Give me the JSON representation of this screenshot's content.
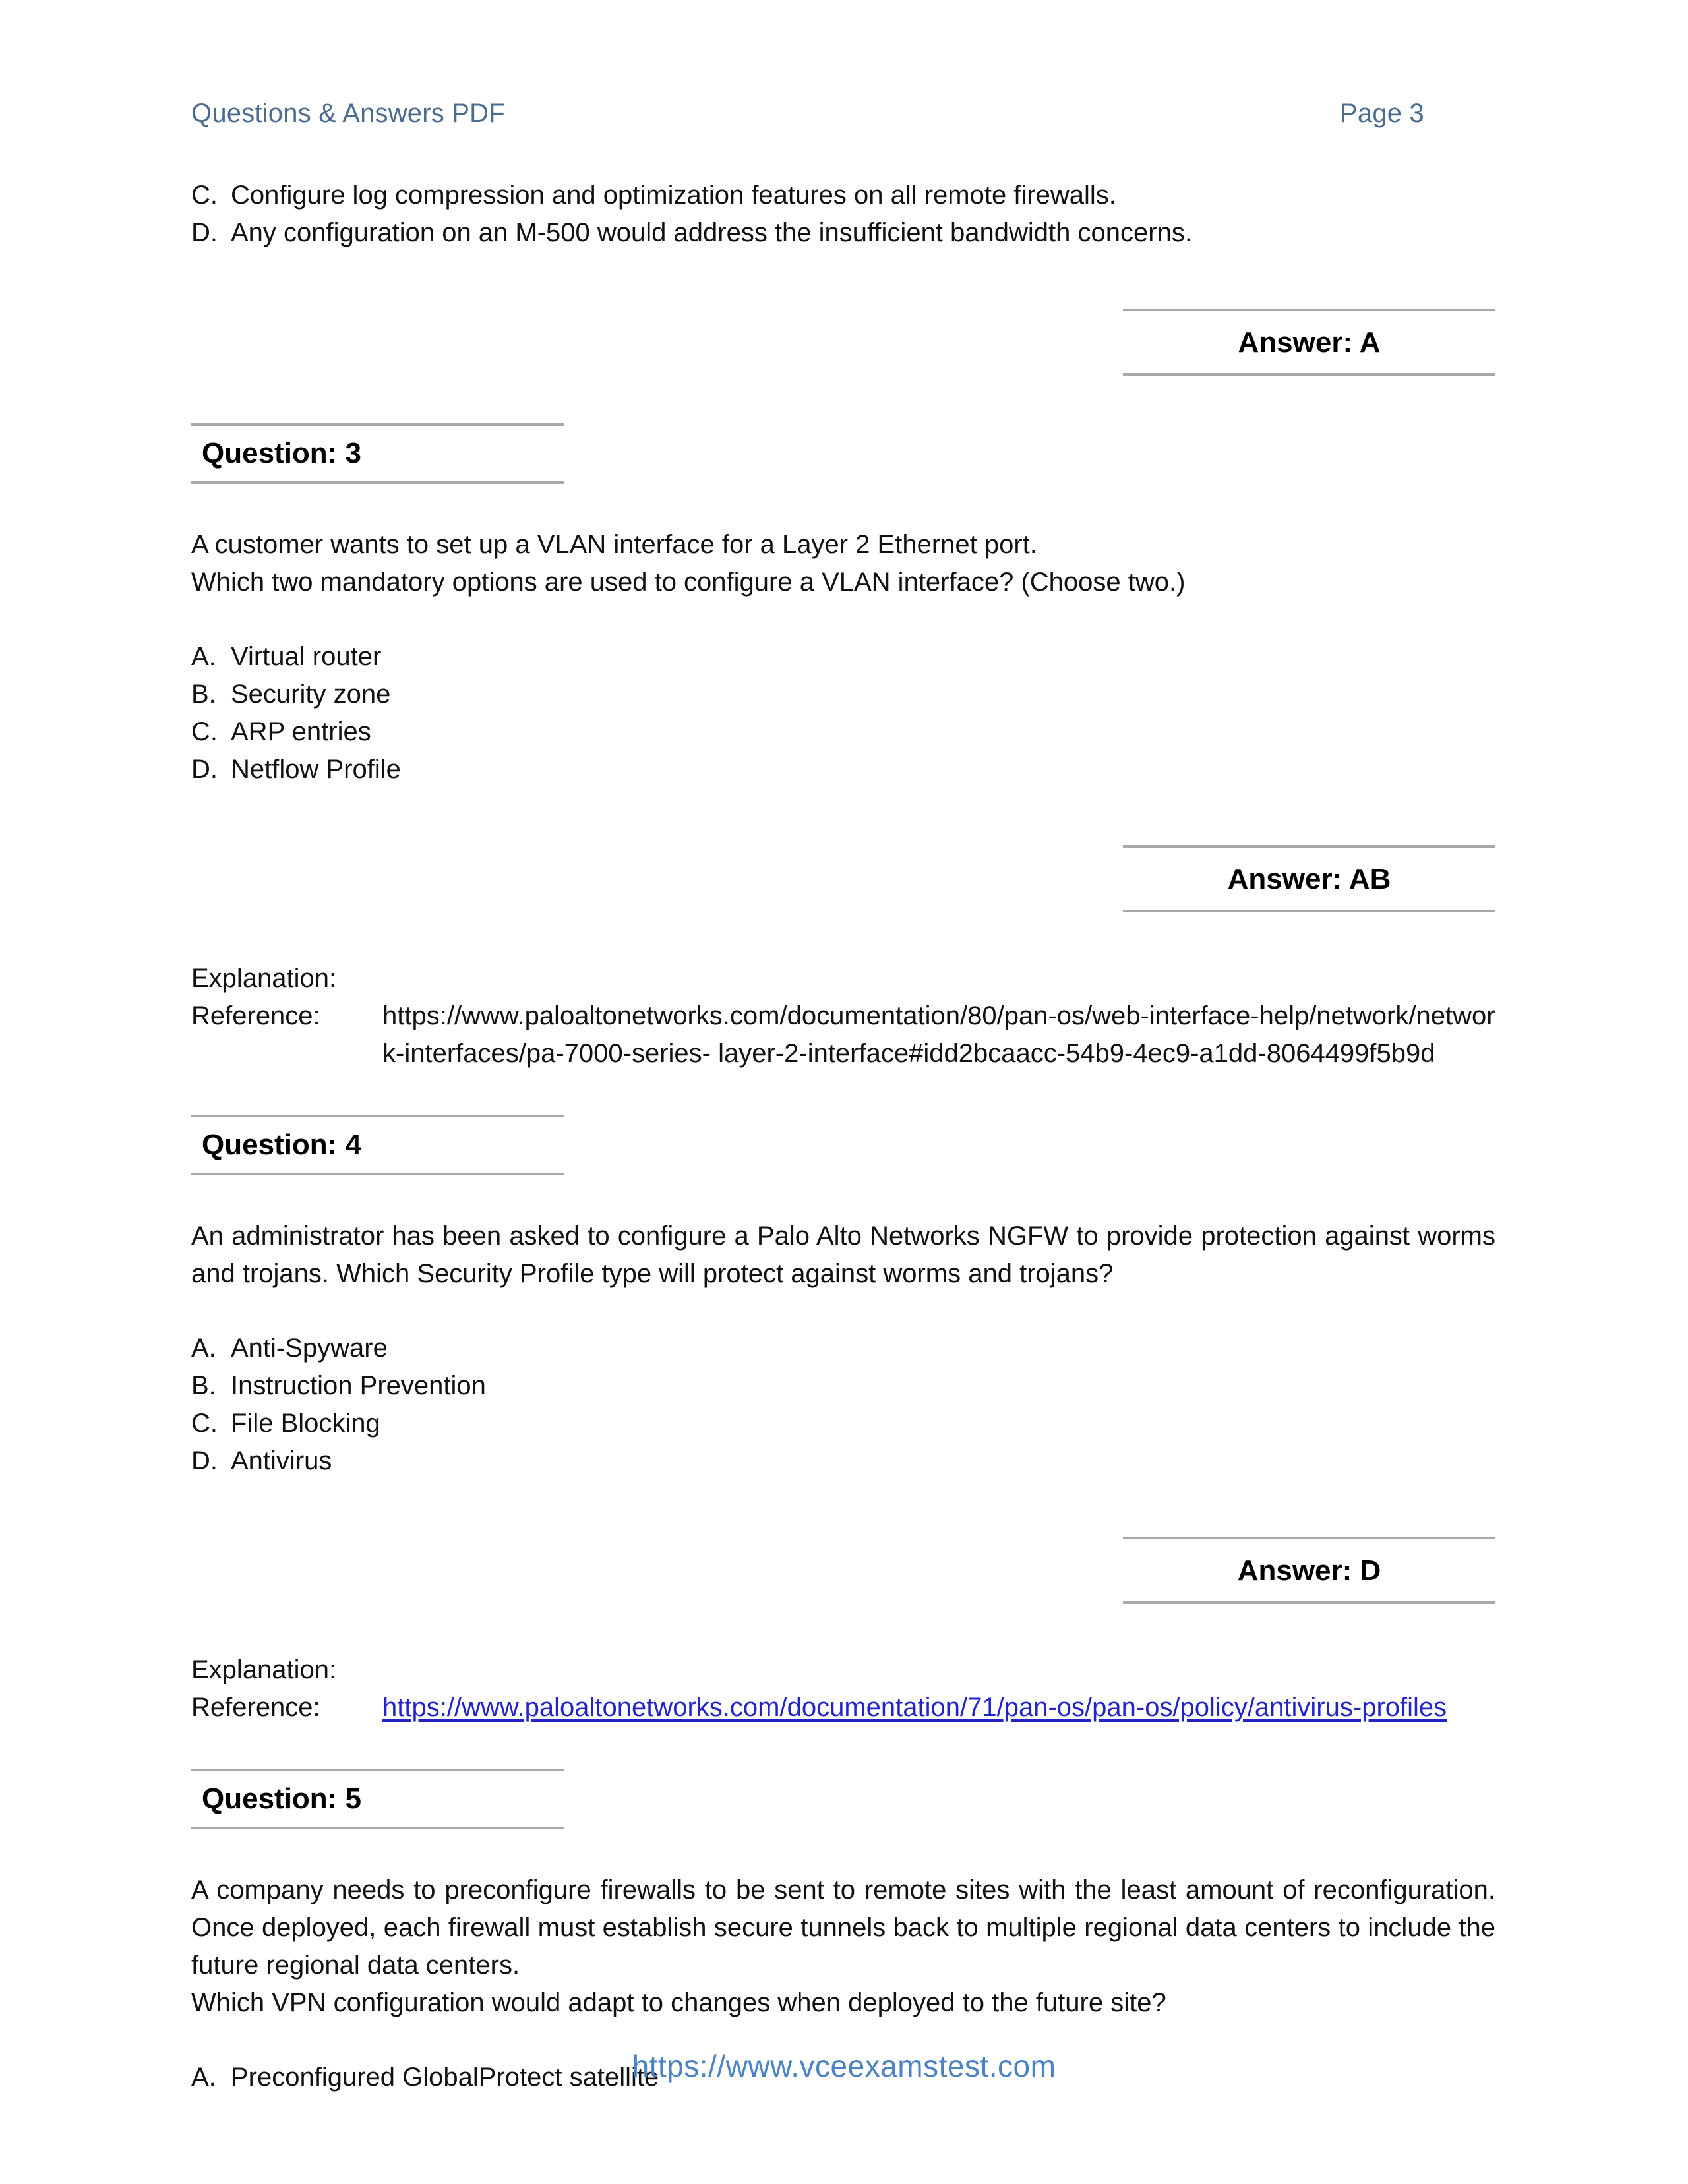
{
  "header": {
    "title": "Questions & Answers PDF",
    "page_label": "Page 3"
  },
  "colors": {
    "header_text": "#4a6c8f",
    "footer_link": "#4a82c4",
    "hyperlink": "#2323cc",
    "rule": "#a8a8a8"
  },
  "carryover": {
    "choices": [
      {
        "marker": "C.",
        "text": "Configure log compression and optimization features on all remote firewalls."
      },
      {
        "marker": "D.",
        "text": "Any configuration on an M-500 would address the insufficient bandwidth concerns."
      }
    ],
    "answer": "Answer: A"
  },
  "questions": [
    {
      "heading": "Question: 3",
      "stem": [
        "A customer wants to set up a VLAN interface for a Layer 2 Ethernet port.",
        "Which two mandatory options are used to configure a VLAN interface? (Choose two.)"
      ],
      "choices": [
        {
          "marker": "A.",
          "text": "Virtual router"
        },
        {
          "marker": "B.",
          "text": "Security zone"
        },
        {
          "marker": "C.",
          "text": "ARP entries"
        },
        {
          "marker": "D.",
          "text": "Netflow Profile"
        }
      ],
      "answer": "Answer: AB",
      "explanation_label": "Explanation:",
      "reference_label": "Reference:",
      "reference_value": "https://www.paloaltonetworks.com/documentation/80/pan-os/web-interface-help/network/network-interfaces/pa-7000-series-        layer-2-interface#idd2bcaacc-54b9-4ec9-a1dd-8064499f5b9d",
      "reference_is_link": false
    },
    {
      "heading": "Question: 4",
      "stem": [
        "An administrator has been asked to configure a Palo Alto Networks NGFW to provide protection against worms and trojans. Which Security Profile type will protect against worms and trojans?"
      ],
      "choices": [
        {
          "marker": "A.",
          "text": "Anti-Spyware"
        },
        {
          "marker": "B.",
          "text": "Instruction Prevention"
        },
        {
          "marker": "C.",
          "text": "File Blocking"
        },
        {
          "marker": "D.",
          "text": "Antivirus"
        }
      ],
      "answer": "Answer: D",
      "explanation_label": "Explanation:",
      "reference_label": "Reference:",
      "reference_value": "https://www.paloaltonetworks.com/documentation/71/pan-os/pan-os/policy/antivirus-profiles",
      "reference_is_link": true
    },
    {
      "heading": "Question: 5",
      "stem": [
        "A company needs to preconfigure firewalls to be sent to remote sites with the least amount of reconfiguration. Once deployed, each firewall must establish secure tunnels back to multiple regional data centers to include the future regional data centers.",
        "Which VPN configuration would adapt to changes when deployed to the future site?"
      ],
      "choices": [
        {
          "marker": "A.",
          "text": "Preconfigured GlobalProtect satellite"
        }
      ],
      "answer": null,
      "explanation_label": null,
      "reference_label": null,
      "reference_value": null,
      "reference_is_link": false
    }
  ],
  "footer": {
    "url": "https://www.vceexamstest.com"
  }
}
